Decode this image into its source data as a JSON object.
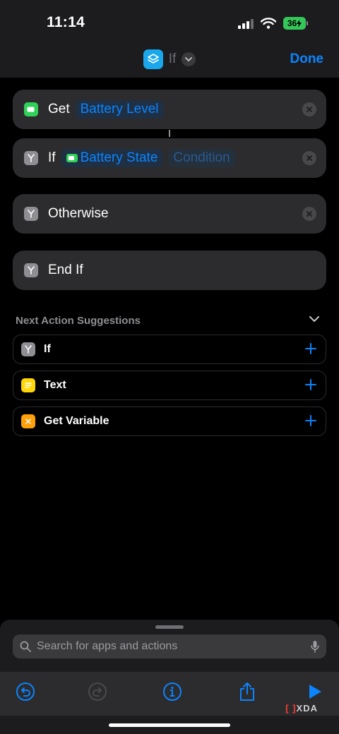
{
  "status": {
    "time": "11:14",
    "battery": "36"
  },
  "header": {
    "title": "If",
    "done_label": "Done"
  },
  "actions": [
    {
      "label": "Get",
      "tokens": [
        "Battery Level"
      ]
    },
    {
      "label": "If",
      "tokens": [
        "Battery State",
        "Condition"
      ]
    },
    {
      "label": "Otherwise"
    },
    {
      "label": "End If"
    }
  ],
  "suggestions": {
    "heading": "Next Action Suggestions",
    "items": [
      {
        "label": "If",
        "icon": "branch-icon"
      },
      {
        "label": "Text",
        "icon": "text-icon"
      },
      {
        "label": "Get Variable",
        "icon": "variable-icon"
      }
    ]
  },
  "search": {
    "placeholder": "Search for apps and actions"
  },
  "watermark": "XDA",
  "colors": {
    "accent": "#0a84ff",
    "battery_green": "#34c759"
  }
}
